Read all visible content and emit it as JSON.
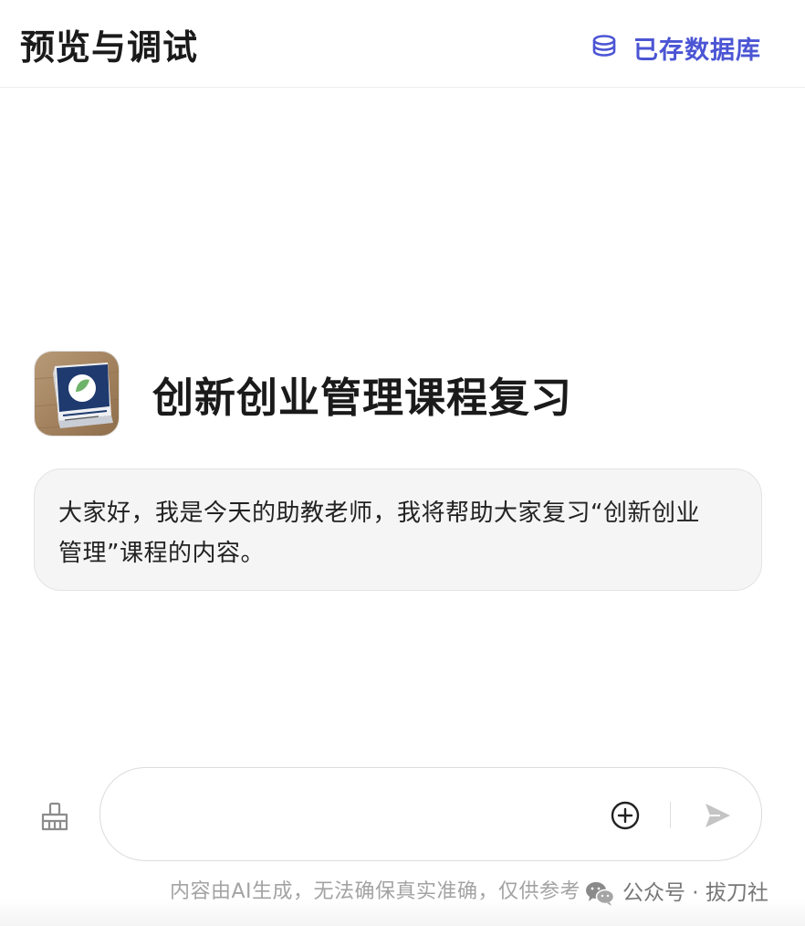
{
  "header": {
    "title": "预览与调试",
    "db_link_label": "已存数据库",
    "db_icon": "database-icon",
    "accent_color": "#4b55d4"
  },
  "bot": {
    "name": "创新创业管理课程复习",
    "avatar_icon": "product-box-avatar"
  },
  "messages": [
    {
      "role": "assistant",
      "line1": "大家好，我是今天的助教老师，我将帮助大家复习“创新创业",
      "line2": "管理”课程的内容。"
    }
  ],
  "composer": {
    "placeholder": "",
    "clear_icon": "broom-icon",
    "add_icon": "plus-circle-icon",
    "send_icon": "send-icon"
  },
  "footer": {
    "disclaimer": "内容由AI生成，无法确保真实准确，仅供参考",
    "watermark_text": "公众号 · 拔刀社",
    "watermark_icon": "wechat-icon"
  }
}
